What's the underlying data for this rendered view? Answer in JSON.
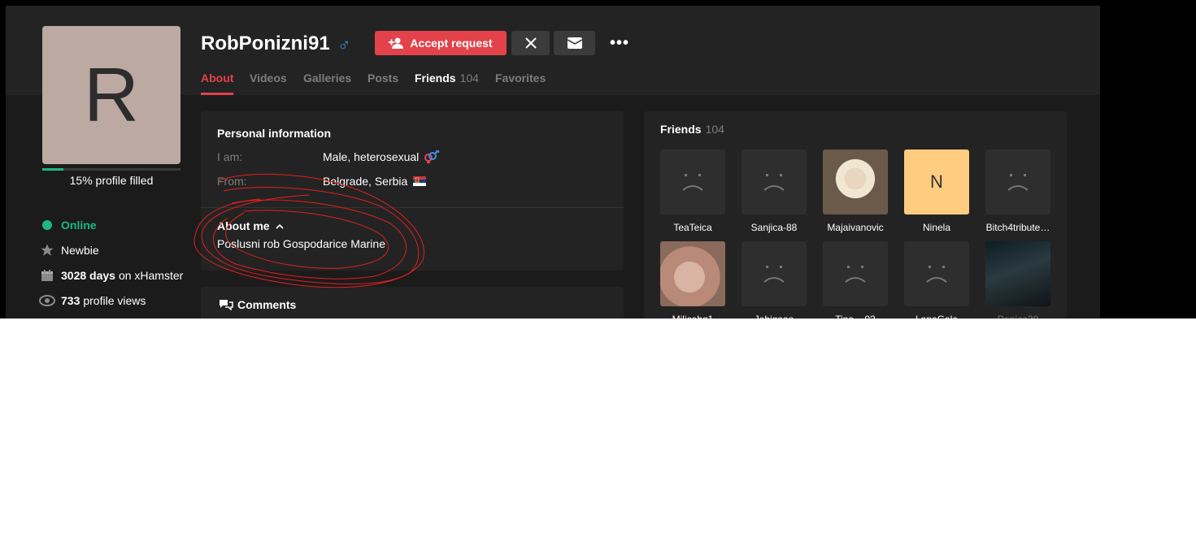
{
  "profile": {
    "initial": "R",
    "username": "RobPonizni91",
    "gender_symbol": "♂",
    "progress_percent": 15,
    "progress_label": "15% profile filled",
    "avatar_color": "#bca9a1"
  },
  "actions": {
    "accept_label": "Accept request",
    "more_label": "•••"
  },
  "tabs": [
    {
      "label": "About"
    },
    {
      "label": "Videos"
    },
    {
      "label": "Galleries"
    },
    {
      "label": "Posts"
    },
    {
      "label": "Friends",
      "count": "104"
    },
    {
      "label": "Favorites"
    }
  ],
  "stats": {
    "online": "Online",
    "level": "Newbie",
    "days_value": "3028 days",
    "days_suffix": "on xHamster",
    "views_value": "733",
    "views_suffix": "profile views"
  },
  "personal": {
    "title": "Personal information",
    "iam_label": "I am:",
    "iam_value": "Male, heterosexual",
    "from_label": "From:",
    "from_value": "Belgrade, Serbia"
  },
  "about": {
    "title": "About me",
    "text": "Poslusni rob Gospodarice Marine"
  },
  "comments": {
    "title": "Comments"
  },
  "friends": {
    "title": "Friends",
    "count": "104",
    "items": [
      {
        "name": "TeaTeica",
        "avatar": "sad-placeholder"
      },
      {
        "name": "Sanjica-88",
        "avatar": "sad-placeholder"
      },
      {
        "name": "Majaivanovic",
        "avatar": "photo"
      },
      {
        "name": "Ninela",
        "avatar": "initial",
        "initial": "N"
      },
      {
        "name": "Bitch4tribute…",
        "avatar": "sad-placeholder"
      },
      {
        "name": "Milicabg1",
        "avatar": "photo"
      },
      {
        "name": "Jebigaaa",
        "avatar": "sad-placeholder"
      },
      {
        "name": "Tina__93",
        "avatar": "sad-placeholder"
      },
      {
        "name": "LanaGala",
        "avatar": "sad-placeholder"
      },
      {
        "name": "Danica39",
        "avatar": "photo"
      }
    ]
  },
  "colors": {
    "accent": "#e3424a",
    "online": "#1fb686",
    "male": "#3d8fe0",
    "initial_avatar": "#ffcc80"
  }
}
